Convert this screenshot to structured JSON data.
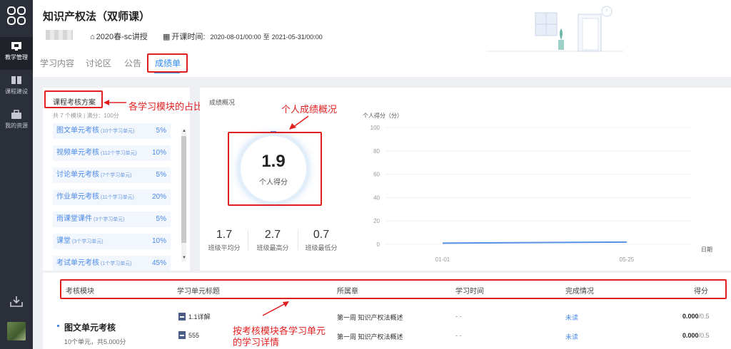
{
  "sidebar": {
    "items": [
      {
        "label": "教学管理",
        "icon": "teaching-icon",
        "active": true
      },
      {
        "label": "课程建设",
        "icon": "book-icon",
        "active": false
      },
      {
        "label": "我的资源",
        "icon": "resource-icon",
        "active": false
      }
    ]
  },
  "header": {
    "title": "知识产权法（双师课）",
    "semester": "2020春-sc讲授",
    "time_label": "开课时间:",
    "start": "2020-08-01/00:00",
    "to": "至",
    "end": "2021-05-31/00:00"
  },
  "tabs": [
    {
      "label": "学习内容",
      "active": false
    },
    {
      "label": "讨论区",
      "active": false
    },
    {
      "label": "公告",
      "active": false
    },
    {
      "label": "成绩单",
      "active": true
    }
  ],
  "plan": {
    "title": "课程考核方案",
    "summary": "共 7 个模块 | 满分：100分",
    "modules": [
      {
        "name": "图文单元考核",
        "units": "(10个学习单元)",
        "pct": "5%"
      },
      {
        "name": "视频单元考核",
        "units": "(112个学习单元)",
        "pct": "10%"
      },
      {
        "name": "讨论单元考核",
        "units": "(7个学习单元)",
        "pct": "5%"
      },
      {
        "name": "作业单元考核",
        "units": "(11个学习单元)",
        "pct": "20%"
      },
      {
        "name": "雨课堂课件",
        "units": "(3个学习单元)",
        "pct": "5%"
      },
      {
        "name": "课堂",
        "units": "(3个学习单元)",
        "pct": "10%"
      },
      {
        "name": "考试单元考核",
        "units": "(1个学习单元)",
        "pct": "45%"
      }
    ]
  },
  "overview": {
    "title": "成绩概况",
    "score": "1.9",
    "score_label": "个人得分",
    "stats": [
      {
        "value": "1.7",
        "label": "班级平均分"
      },
      {
        "value": "2.7",
        "label": "班级最高分"
      },
      {
        "value": "0.7",
        "label": "班级最低分"
      }
    ]
  },
  "chart_data": {
    "type": "line",
    "ylabel": "个人得分（分）",
    "xlabel": "日期",
    "ylim": [
      0,
      100
    ],
    "yticks": [
      0,
      20,
      40,
      60,
      80,
      100
    ],
    "x": [
      "01-01",
      "05-25"
    ],
    "series": [
      {
        "values": [
          1.0,
          1.9
        ]
      }
    ],
    "grid": true,
    "color": "#5a8fe6"
  },
  "annotations": {
    "module_share": "各学习模块的占比",
    "personal_overview": "个人成绩概况",
    "details_line1": "按考核模块各学习单元",
    "details_line2": "的学习详情"
  },
  "table": {
    "headers": [
      "考核模块",
      "学习单元标题",
      "所属章",
      "学习时间",
      "完成情况",
      "得分"
    ],
    "module": {
      "name": "图文单元考核",
      "desc": "10个单元，共5.000分"
    },
    "rows": [
      {
        "title": "1.1详解",
        "chapter": "第一周 知识产权法概述",
        "time": "- -",
        "status": "未读",
        "score": "0.000",
        "total": "/0.5"
      },
      {
        "title": "555",
        "chapter": "第一周 知识产权法概述",
        "time": "- -",
        "status": "未读",
        "score": "0.000",
        "total": "/0.5"
      }
    ]
  }
}
